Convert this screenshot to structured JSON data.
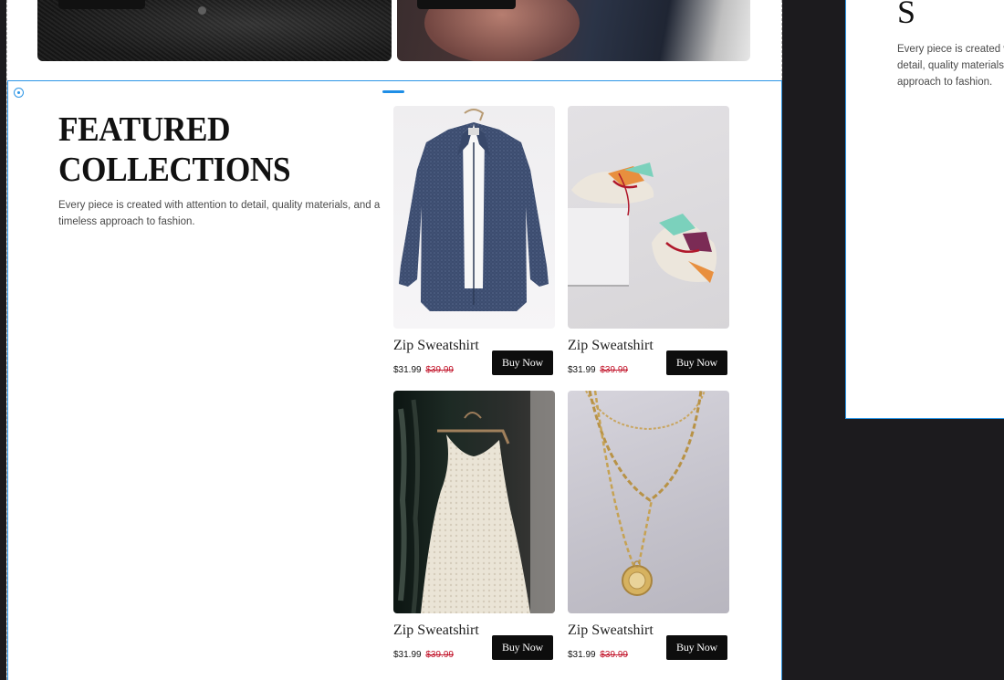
{
  "section": {
    "title_line1": "FEATURED",
    "title_line2": "COLLECTIONS",
    "description": "Every piece is created with attention to detail, quality materials, and a timeless approach to fashion."
  },
  "products": [
    {
      "name": "Zip Sweatshirt",
      "price": "$31.99",
      "old_price": "$39.99",
      "button": "Buy Now",
      "image": "denim-shirt-photo"
    },
    {
      "name": "Zip Sweatshirt",
      "price": "$31.99",
      "old_price": "$39.99",
      "button": "Buy Now",
      "image": "sneakers-photo"
    },
    {
      "name": "Zip Sweatshirt",
      "price": "$31.99",
      "old_price": "$39.99",
      "button": "Buy Now",
      "image": "wedding-dress-photo"
    },
    {
      "name": "Zip Sweatshirt",
      "price": "$31.99",
      "old_price": "$39.99",
      "button": "Buy Now",
      "image": "gold-necklace-photo"
    }
  ],
  "right_panel": {
    "title": "S",
    "description": "Every piece is created with attention to detail, quality materials, and a timeless approach to fashion."
  },
  "colors": {
    "selection": "#2d96e6",
    "sale_price": "#c2152b",
    "button_bg": "#0d0d0d",
    "workspace_bg": "#1c1b1e"
  }
}
